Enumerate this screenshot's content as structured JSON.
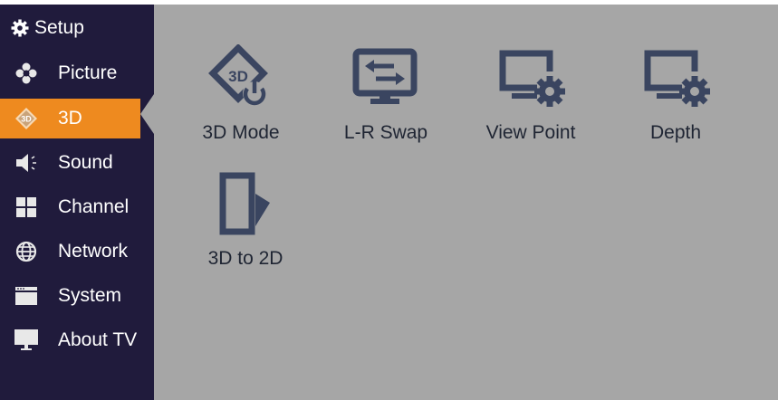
{
  "sidebar": {
    "header": {
      "label": "Setup",
      "icon": "gear-icon"
    },
    "items": [
      {
        "label": "Picture",
        "icon": "flower-icon",
        "active": false
      },
      {
        "label": "3D",
        "icon": "3d-badge-icon",
        "active": true
      },
      {
        "label": "Sound",
        "icon": "speaker-icon",
        "active": false
      },
      {
        "label": "Channel",
        "icon": "grid-icon",
        "active": false
      },
      {
        "label": "Network",
        "icon": "globe-icon",
        "active": false
      },
      {
        "label": "System",
        "icon": "window-icon",
        "active": false
      },
      {
        "label": "About TV",
        "icon": "monitor-icon",
        "active": false
      }
    ]
  },
  "main": {
    "tiles": [
      {
        "label": "3D Mode",
        "icon": "3d-power-icon"
      },
      {
        "label": "L-R Swap",
        "icon": "swap-monitor-icon"
      },
      {
        "label": "View Point",
        "icon": "monitor-gear-icon"
      },
      {
        "label": "Depth",
        "icon": "monitor-gear-icon"
      },
      {
        "label": "3D to 2D",
        "icon": "fold-page-icon"
      }
    ]
  },
  "colors": {
    "sidebar_bg": "#201b3c",
    "main_bg": "#a6a6a6",
    "accent": "#ee8a1f",
    "icon_color": "#3a4560"
  }
}
